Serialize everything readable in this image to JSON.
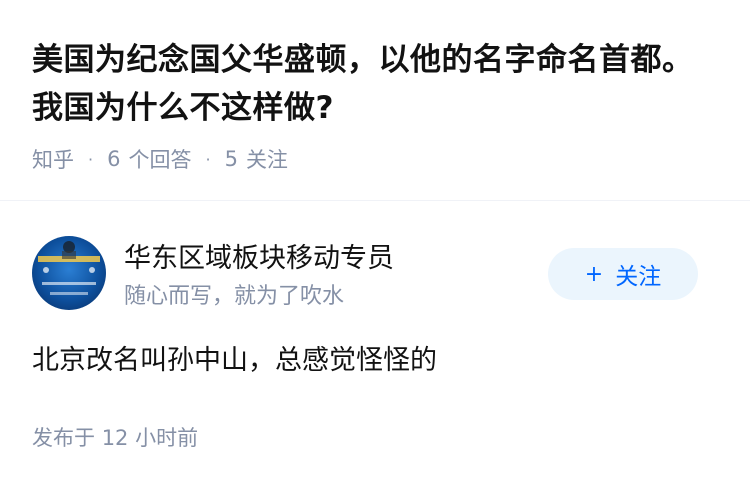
{
  "question": {
    "title": "美国为纪念国父华盛顿，以他的名字命名首都。我国为什么不这样做?",
    "source": "知乎",
    "separator": "·",
    "answer_count": "6",
    "answer_label": "个回答",
    "follower_count": "5",
    "follower_label": "关注"
  },
  "author": {
    "name": "华东区域板块移动专员",
    "bio": "随心而写，就为了吹水",
    "avatar_icon": "avatar-image",
    "follow_button": {
      "icon": "plus-icon",
      "plus": "+",
      "label": "关注"
    }
  },
  "answer": {
    "content": "北京改名叫孙中山，总感觉怪怪的",
    "publish_prefix": "发布于",
    "publish_time": "12 小时前"
  },
  "colors": {
    "title": "#121212",
    "meta": "#8590a6",
    "accent": "#0066ff",
    "follow_bg": "#ebf5fd",
    "divider": "#f0f2f7"
  }
}
